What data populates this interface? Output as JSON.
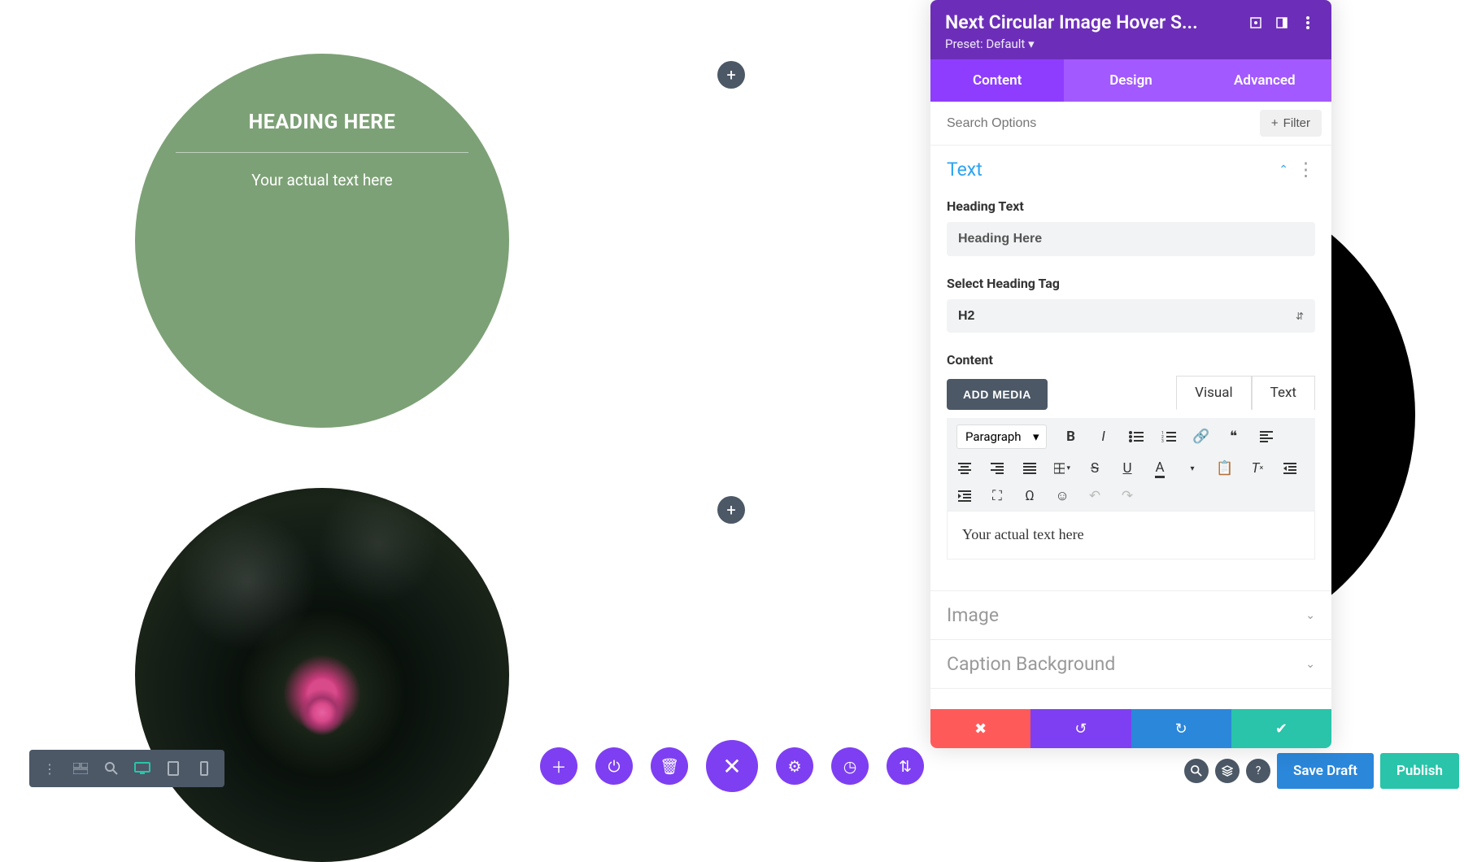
{
  "canvas": {
    "circle1": {
      "heading": "HEADING HERE",
      "text": "Your actual text here"
    },
    "addIcon": "+"
  },
  "panel": {
    "title": "Next Circular Image Hover S...",
    "presetLabel": "Preset:",
    "presetValue": "Default",
    "tabs": {
      "content": "Content",
      "design": "Design",
      "advanced": "Advanced"
    },
    "searchPlaceholder": "Search Options",
    "filterLabel": "Filter",
    "sections": {
      "text": {
        "title": "Text",
        "headingTextLabel": "Heading Text",
        "headingTextValue": "Heading Here",
        "selectHeadingTagLabel": "Select Heading Tag",
        "selectHeadingTagValue": "H2",
        "contentLabel": "Content",
        "addMedia": "ADD MEDIA",
        "editorTabs": {
          "visual": "Visual",
          "text": "Text"
        },
        "toolbarFormat": "Paragraph",
        "editorContent": "Your actual text here"
      },
      "image": {
        "title": "Image"
      },
      "captionBg": {
        "title": "Caption Background"
      }
    }
  },
  "bottomRight": {
    "saveDraft": "Save Draft",
    "publish": "Publish"
  }
}
